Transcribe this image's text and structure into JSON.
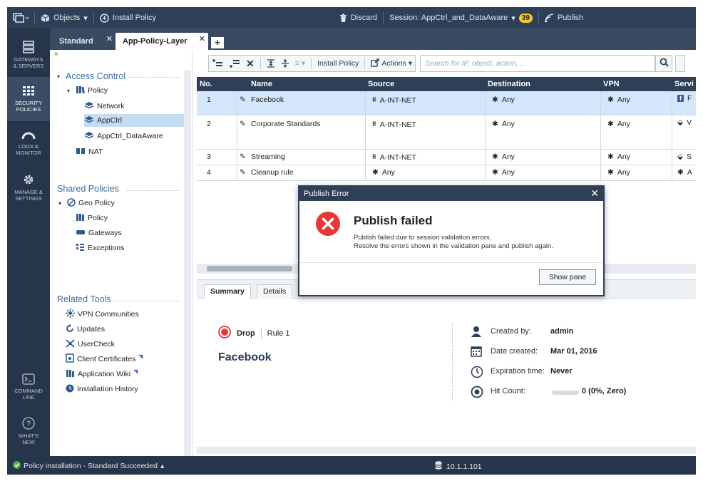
{
  "topbar": {
    "objects_label": "Objects",
    "install_policy_label": "Install Policy",
    "discard_label": "Discard",
    "session_label": "Session: AppCtrl_and_DataAware",
    "session_count": "39",
    "publish_label": "Publish"
  },
  "leftnav": {
    "items": [
      {
        "label_1": "GATEWAYS",
        "label_2": "& SERVERS"
      },
      {
        "label_1": "SECURITY",
        "label_2": "POLICIES"
      },
      {
        "label_1": "LOGS &",
        "label_2": "MONITOR"
      },
      {
        "label_1": "MANAGE &",
        "label_2": "SETTINGS"
      },
      {
        "label_1": "COMMAND",
        "label_2": "LINE"
      },
      {
        "label_1": "WHAT'S",
        "label_2": "NEW"
      }
    ]
  },
  "tabs": {
    "standard": "Standard",
    "app_policy_layer": "App-Policy-Layer"
  },
  "tree": {
    "access_control": "Access Control",
    "policy": "Policy",
    "network": "Network",
    "appctrl": "AppCtrl",
    "appctrl_dataaware": "AppCtrl_DataAware",
    "nat": "NAT",
    "shared_policies": "Shared Policies",
    "geo_policy": "Geo Policy",
    "shared_policy": "Policy",
    "gateways": "Gateways",
    "exceptions": "Exceptions",
    "related_tools": "Related Tools",
    "vpn_communities": "VPN Communities",
    "updates": "Updates",
    "usercheck": "UserCheck",
    "client_certificates": "Client Certificates",
    "application_wiki": "Application Wiki",
    "installation_history": "Installation History"
  },
  "toolbar": {
    "install_policy": "Install Policy",
    "actions": "Actions",
    "search_placeholder": "Search for IP, object, action, ..."
  },
  "table": {
    "headers": [
      "No.",
      "Name",
      "Source",
      "Destination",
      "VPN",
      "Servi"
    ],
    "rows": [
      {
        "no": "1",
        "name": "Facebook",
        "source": "A-INT-NET",
        "destination": "Any",
        "vpn": "Any",
        "service": "F"
      },
      {
        "no": "2",
        "name": "Corporate Standards",
        "source": "A-INT-NET",
        "destination": "Any",
        "vpn": "Any",
        "service": "V"
      },
      {
        "no": "3",
        "name": "Streaming",
        "source": "A-INT-NET",
        "destination": "Any",
        "vpn": "Any",
        "service": "S"
      },
      {
        "no": "4",
        "name": "Cleanup rule",
        "source": "Any",
        "destination": "Any",
        "vpn": "Any",
        "service": "A"
      }
    ]
  },
  "details": {
    "tab_summary": "Summary",
    "tab_details": "Details",
    "action": "Drop",
    "rule": "Rule 1",
    "rule_name": "Facebook",
    "created_by_label": "Created by:",
    "created_by": "admin",
    "date_created_label": "Date created:",
    "date_created": "Mar 01, 2016",
    "expiration_label": "Expiration time:",
    "expiration": "Never",
    "hit_count_label": "Hit Count:",
    "hit_count": "0 (0%, Zero)"
  },
  "statusbar": {
    "message": "Policy installation - Standard Succeeded",
    "server": "10.1.1.101"
  },
  "dialog": {
    "title": "Publish Error",
    "heading": "Publish failed",
    "message_1": "Publish failed due to session validation errors.",
    "message_2": "Resolve the errors shown in the validation pane and publish again.",
    "button": "Show pane"
  },
  "colors": {
    "topbar": "#2e3f57",
    "leftnav": "#26354a",
    "accent_blue": "#3d6fa6",
    "error_red": "#e53935",
    "selection": "#d3e6fa",
    "status_green": "#4caf50"
  }
}
